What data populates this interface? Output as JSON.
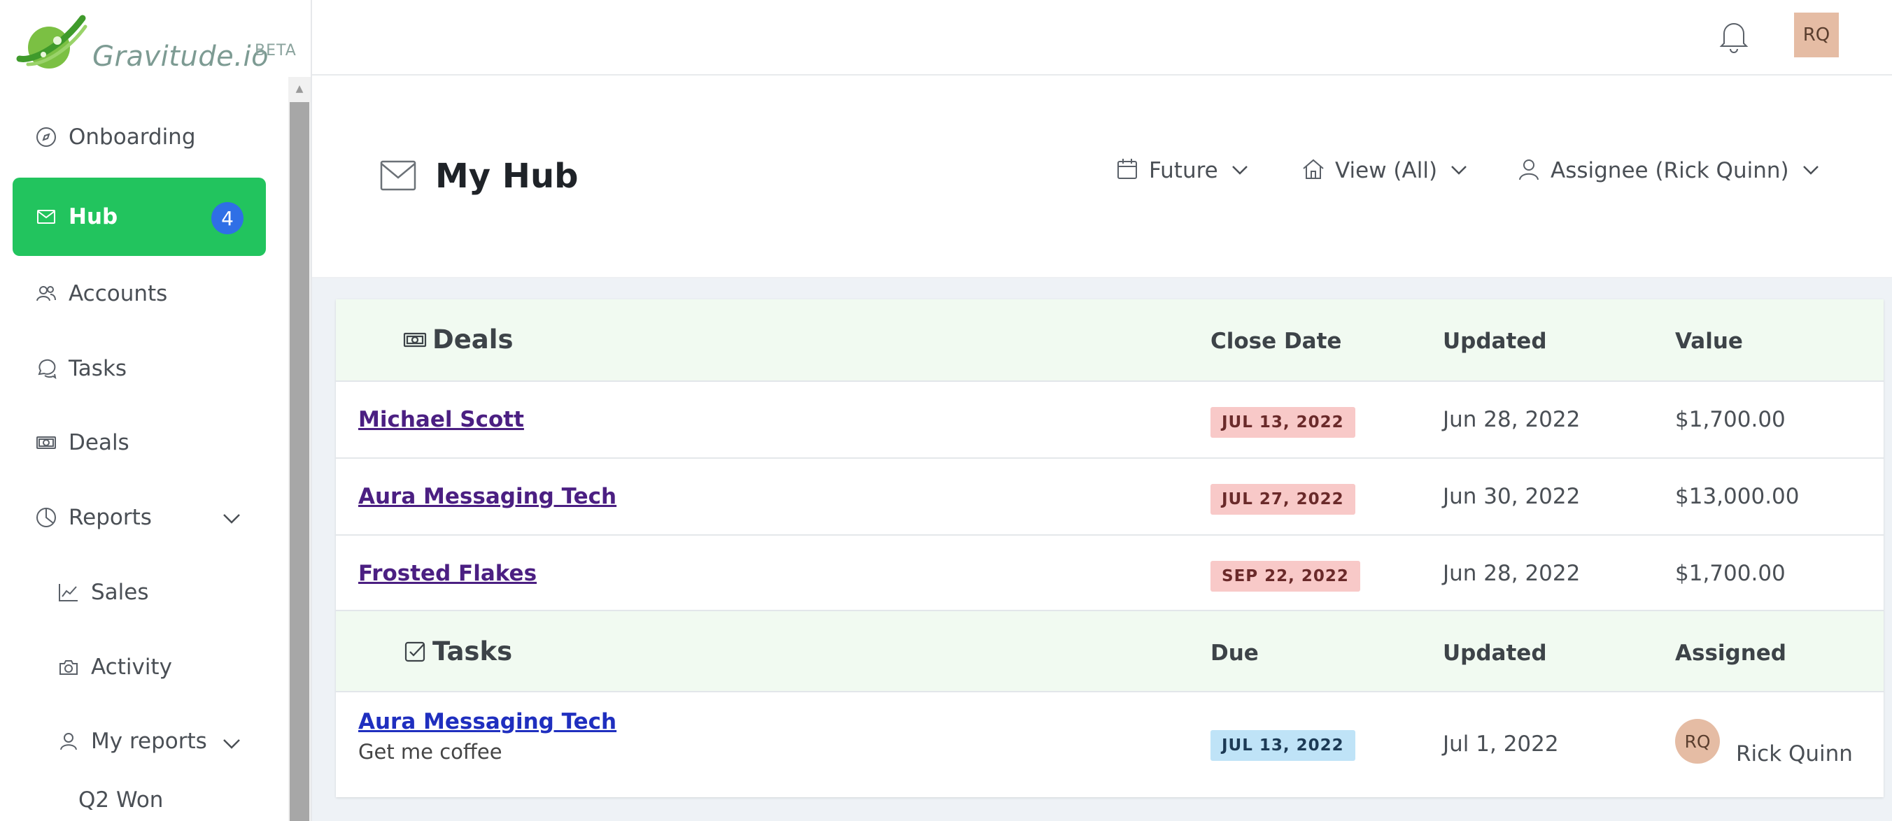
{
  "brand": {
    "name": "Gravitude.io",
    "tag": "BETA"
  },
  "sidebar": {
    "items": [
      {
        "label": "Onboarding",
        "icon": "compass-icon"
      },
      {
        "label": "Hub",
        "icon": "envelope-icon",
        "badge": "4",
        "active": true
      },
      {
        "label": "Accounts",
        "icon": "users-icon"
      },
      {
        "label": "Tasks",
        "icon": "chat-icon"
      },
      {
        "label": "Deals",
        "icon": "banknote-icon"
      },
      {
        "label": "Reports",
        "icon": "pie-chart-icon"
      },
      {
        "label": "Sales",
        "icon": "trend-icon"
      },
      {
        "label": "Activity",
        "icon": "camera-icon"
      },
      {
        "label": "My reports",
        "icon": "user-icon"
      },
      {
        "label": "Q2 Won",
        "icon": "dot-icon"
      }
    ]
  },
  "topbar": {
    "user_initials": "RQ"
  },
  "header": {
    "title": "My Hub",
    "filters": {
      "time": "Future",
      "view": "View (All)",
      "assignee": "Assignee (Rick Quinn)"
    }
  },
  "deals": {
    "title": "Deals",
    "columns": [
      "Close Date",
      "Updated",
      "Value"
    ],
    "rows": [
      {
        "name": "Michael Scott",
        "close": "JUL 13, 2022",
        "updated": "Jun 28, 2022",
        "value": "$1,700.00"
      },
      {
        "name": "Aura Messaging Tech",
        "close": "JUL 27, 2022",
        "updated": "Jun 30, 2022",
        "value": "$13,000.00"
      },
      {
        "name": "Frosted Flakes",
        "close": "SEP 22, 2022",
        "updated": "Jun 28, 2022",
        "value": "$1,700.00"
      }
    ]
  },
  "tasks": {
    "title": "Tasks",
    "columns": [
      "Due",
      "Updated",
      "Assigned"
    ],
    "rows": [
      {
        "account": "Aura Messaging Tech",
        "task": "Get me coffee",
        "due": "JUL 13, 2022",
        "updated": "Jul 1, 2022",
        "assignee_initials": "RQ",
        "assignee": "Rick Quinn"
      }
    ]
  },
  "colors": {
    "accent": "#22c45e",
    "badge": "#2f6fe6",
    "section_bg": "#f1faf1",
    "overdue_pill": "#f8c9c8",
    "due_pill": "#bfe3f7",
    "link": "#4b1f82"
  }
}
